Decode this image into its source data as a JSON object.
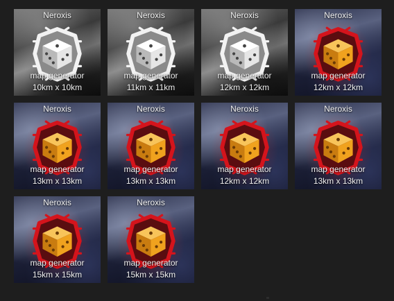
{
  "tiles": [
    {
      "title": "Neroxis",
      "line1": "map generator",
      "line2": "10km x 10km",
      "style": "grey"
    },
    {
      "title": "Neroxis",
      "line1": "map generator",
      "line2": "11km x 11km",
      "style": "grey"
    },
    {
      "title": "Neroxis",
      "line1": "map generator",
      "line2": "12km x 12km",
      "style": "grey"
    },
    {
      "title": "Neroxis",
      "line1": "map generator",
      "line2": "12km x 12km",
      "style": "red"
    },
    {
      "title": "Neroxis",
      "line1": "map generator",
      "line2": "13km x 13km",
      "style": "red"
    },
    {
      "title": "Neroxis",
      "line1": "map generator",
      "line2": "13km x 13km",
      "style": "red"
    },
    {
      "title": "Neroxis",
      "line1": "map generator",
      "line2": "12km x 12km",
      "style": "red"
    },
    {
      "title": "Neroxis",
      "line1": "map generator",
      "line2": "13km x 13km",
      "style": "red"
    },
    {
      "title": "Neroxis",
      "line1": "map generator",
      "line2": "15km x 15km",
      "style": "red"
    },
    {
      "title": "Neroxis",
      "line1": "map generator",
      "line2": "15km x 15km",
      "style": "red"
    }
  ],
  "colors": {
    "background": "#1e1e1e",
    "grey_badge": "#f2f2f2",
    "grey_die": "#e6e6e6",
    "red_badge": "#d4141c",
    "gold_die": "#f0a21e"
  },
  "icons": {
    "grey_emblem": "dice-icon-grey",
    "red_emblem": "dice-icon-red"
  }
}
